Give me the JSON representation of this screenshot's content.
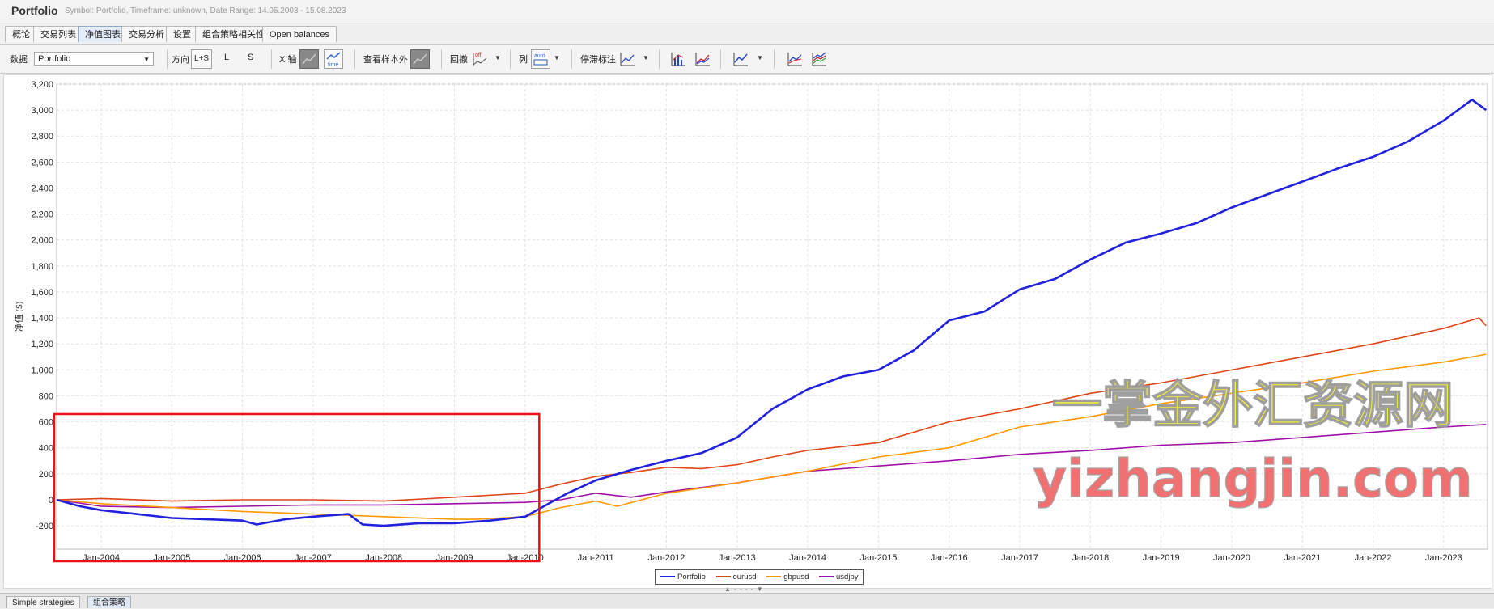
{
  "window": {
    "title": "Portfolio",
    "subtitle": "Symbol: Portfolio, Timeframe: unknown, Date Range: 14.05.2003 - 15.08.2023"
  },
  "tabs": [
    "概论",
    "交易列表",
    "净值图表",
    "交易分析",
    "设置",
    "组合策略相关性",
    "Open balances"
  ],
  "active_tab": "净值图表",
  "toolbar": {
    "data_label": "数据",
    "data_value": "Portfolio",
    "direction_label": "方向",
    "dir_ls": "L+S",
    "dir_l": "L",
    "dir_s": "S",
    "xaxis_label": "X 轴",
    "time_icon_text": "time",
    "oos_label": "查看样本外",
    "drawdown_label": "回撤",
    "off_text": "off",
    "columns_label": "列",
    "auto_text": "auto",
    "stagnation_label": "停滞标注"
  },
  "icons": [
    "dropdown-arrow-icon",
    "xaxis-trades-icon",
    "xaxis-time-icon",
    "oos-toggle-icon",
    "drawdown-off-icon",
    "columns-auto-icon",
    "stagnation-icon",
    "bar-chart-icon",
    "line-chart-icon",
    "equity-chart-icon",
    "single-line-icon",
    "multi-line-icon"
  ],
  "colors": {
    "Portfolio": "#2222dd",
    "eurusd": "#e04418",
    "gbpusd": "#ff9900",
    "usdjpy": "#a010a8",
    "highlight_box": "#ee1111"
  },
  "watermark": {
    "line1": "一掌金外汇资源网",
    "line2": "yizhangjin.com"
  },
  "chart_data": {
    "type": "line",
    "ylabel": "净值 ($)",
    "xlabel": "",
    "ylim": [
      -380,
      3200
    ],
    "xlim": [
      2003.37,
      2023.62
    ],
    "yticks": [
      -200,
      0,
      200,
      400,
      600,
      800,
      1000,
      1200,
      1400,
      1600,
      1800,
      2000,
      2200,
      2400,
      2600,
      2800,
      3000,
      3200
    ],
    "ytick_labels": [
      "-200",
      "0",
      "200",
      "400",
      "600",
      "800",
      "1,000",
      "1,200",
      "1,400",
      "1,600",
      "1,800",
      "2,000",
      "2,200",
      "2,400",
      "2,600",
      "2,800",
      "3,000",
      "3,200"
    ],
    "xticks": [
      2004,
      2005,
      2006,
      2007,
      2008,
      2009,
      2010,
      2011,
      2012,
      2013,
      2014,
      2015,
      2016,
      2017,
      2018,
      2019,
      2020,
      2021,
      2022,
      2023
    ],
    "xtick_labels": [
      "Jan-2004",
      "Jan-2005",
      "Jan-2006",
      "Jan-2007",
      "Jan-2008",
      "Jan-2009",
      "Jan-2010",
      "Jan-2011",
      "Jan-2012",
      "Jan-2013",
      "Jan-2014",
      "Jan-2015",
      "Jan-2016",
      "Jan-2017",
      "Jan-2018",
      "Jan-2019",
      "Jan-2020",
      "Jan-2021",
      "Jan-2022",
      "Jan-2023"
    ],
    "grid": true,
    "legend_position": "bottom-center",
    "highlight_region": {
      "x": [
        2003.37,
        2010.2
      ],
      "y": [
        -380,
        660
      ]
    },
    "series": [
      {
        "name": "Portfolio",
        "x": [
          2003.37,
          2003.7,
          2004.0,
          2004.5,
          2005.0,
          2005.5,
          2006.0,
          2006.2,
          2006.6,
          2007.0,
          2007.5,
          2007.7,
          2008.0,
          2008.5,
          2009.0,
          2009.5,
          2010.0,
          2010.3,
          2010.6,
          2011.0,
          2011.5,
          2012.0,
          2012.5,
          2013.0,
          2013.5,
          2014.0,
          2014.5,
          2015.0,
          2015.5,
          2016.0,
          2016.5,
          2017.0,
          2017.5,
          2018.0,
          2018.5,
          2019.0,
          2019.5,
          2020.0,
          2020.5,
          2021.0,
          2021.5,
          2022.0,
          2022.5,
          2023.0,
          2023.4,
          2023.6
        ],
        "y": [
          0,
          -50,
          -80,
          -110,
          -140,
          -150,
          -160,
          -190,
          -150,
          -130,
          -110,
          -190,
          -200,
          -180,
          -180,
          -160,
          -130,
          -40,
          50,
          150,
          230,
          300,
          360,
          480,
          700,
          850,
          950,
          1000,
          1150,
          1380,
          1450,
          1620,
          1700,
          1850,
          1980,
          2050,
          2130,
          2250,
          2350,
          2450,
          2550,
          2640,
          2760,
          2920,
          3080,
          3000
        ]
      },
      {
        "name": "eurusd",
        "x": [
          2003.37,
          2004.0,
          2005.0,
          2006.0,
          2007.0,
          2008.0,
          2009.0,
          2010.0,
          2010.5,
          2011.0,
          2011.5,
          2012.0,
          2012.5,
          2013.0,
          2013.5,
          2014.0,
          2015.0,
          2016.0,
          2017.0,
          2018.0,
          2019.0,
          2020.0,
          2021.0,
          2022.0,
          2023.0,
          2023.5,
          2023.6
        ],
        "y": [
          0,
          10,
          -10,
          0,
          0,
          -10,
          20,
          50,
          120,
          180,
          210,
          250,
          240,
          270,
          330,
          380,
          440,
          600,
          700,
          820,
          900,
          1000,
          1100,
          1200,
          1320,
          1400,
          1340
        ]
      },
      {
        "name": "gbpusd",
        "x": [
          2003.37,
          2004.0,
          2005.0,
          2006.0,
          2007.0,
          2008.0,
          2009.0,
          2009.3,
          2010.0,
          2010.5,
          2011.0,
          2011.3,
          2012.0,
          2013.0,
          2014.0,
          2015.0,
          2016.0,
          2017.0,
          2018.0,
          2019.0,
          2020.0,
          2021.0,
          2022.0,
          2023.0,
          2023.6
        ],
        "y": [
          0,
          -30,
          -60,
          -90,
          -110,
          -130,
          -150,
          -150,
          -130,
          -60,
          -10,
          -50,
          50,
          130,
          220,
          330,
          400,
          560,
          640,
          740,
          820,
          900,
          990,
          1060,
          1120
        ]
      },
      {
        "name": "usdjpy",
        "x": [
          2003.37,
          2004.0,
          2005.0,
          2006.0,
          2007.0,
          2008.0,
          2009.0,
          2010.0,
          2010.5,
          2011.0,
          2011.5,
          2012.0,
          2013.0,
          2014.0,
          2015.0,
          2016.0,
          2017.0,
          2018.0,
          2019.0,
          2020.0,
          2021.0,
          2022.0,
          2023.0,
          2023.6
        ],
        "y": [
          0,
          -50,
          -60,
          -50,
          -40,
          -40,
          -30,
          -20,
          0,
          50,
          20,
          60,
          130,
          220,
          260,
          300,
          350,
          380,
          420,
          440,
          480,
          520,
          560,
          580
        ]
      }
    ]
  }
}
